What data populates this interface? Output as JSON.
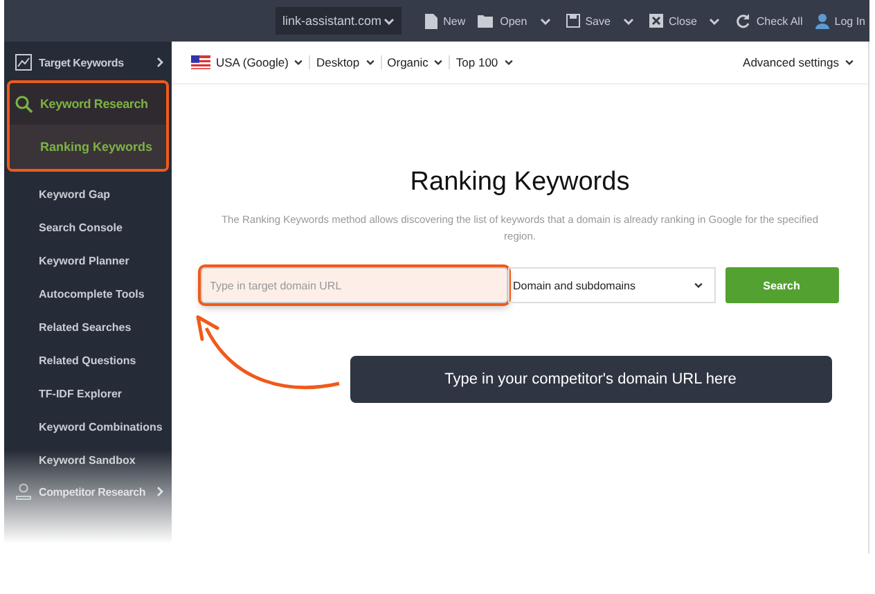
{
  "toolbar": {
    "project": "link-assistant.com",
    "actions": [
      {
        "kind": "new",
        "label": "New",
        "dropdown": false
      },
      {
        "kind": "open",
        "label": "Open",
        "dropdown": true
      },
      {
        "kind": "save",
        "label": "Save",
        "dropdown": true
      },
      {
        "kind": "close",
        "label": "Close",
        "dropdown": true
      },
      {
        "kind": "check",
        "label": "Check All",
        "dropdown": false
      },
      {
        "kind": "user",
        "label": "Log In",
        "dropdown": false
      }
    ]
  },
  "sidebar": {
    "sections": [
      {
        "kind": "chart",
        "label": "Target Keywords",
        "expanded": false,
        "highlighted": false
      },
      {
        "kind": "search",
        "label": "Keyword Research",
        "expanded": true,
        "highlighted": true,
        "children": [
          {
            "label": "Ranking Keywords",
            "selected": true
          },
          {
            "label": "Keyword Gap",
            "selected": false
          },
          {
            "label": "Search Console",
            "selected": false
          },
          {
            "label": "Keyword Planner",
            "selected": false
          },
          {
            "label": "Autocomplete Tools",
            "selected": false
          },
          {
            "label": "Related Searches",
            "selected": false
          },
          {
            "label": "Related Questions",
            "selected": false
          },
          {
            "label": "TF-IDF Explorer",
            "selected": false
          },
          {
            "label": "Keyword Combinations",
            "selected": false
          },
          {
            "label": "Keyword Sandbox",
            "selected": false
          }
        ]
      },
      {
        "kind": "person",
        "label": "Competitor Research",
        "expanded": false,
        "highlighted": false
      }
    ]
  },
  "filters": [
    {
      "kind": "flag",
      "label": "USA (Google)"
    },
    {
      "kind": "plain",
      "label": "Desktop"
    },
    {
      "kind": "plain",
      "label": "Organic"
    },
    {
      "kind": "plain",
      "label": "Top 100"
    }
  ],
  "advanced_settings": "Advanced settings",
  "heading": "Ranking Keywords",
  "description": "The Ranking Keywords method allows discovering the list of keywords that a domain is already ranking in Google for the specified region.",
  "domain_input": {
    "placeholder": "Type in target domain URL",
    "highlighted": true
  },
  "scope_select": "Domain and subdomains",
  "search_button": "Search",
  "callout": "Type in your competitor's domain URL here"
}
